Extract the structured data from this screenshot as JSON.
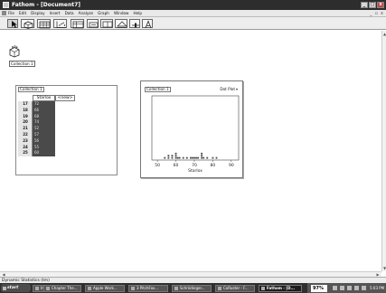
{
  "window": {
    "title": "Fathom - [Document7]",
    "controls": [
      "_",
      "□",
      "x"
    ]
  },
  "menubar": {
    "items": [
      "File",
      "Edit",
      "Display",
      "Insert",
      "Data",
      "Analyze",
      "Graph",
      "Window",
      "Help"
    ],
    "mdi_controls": [
      "_",
      "▫",
      "x"
    ]
  },
  "toolbar": {
    "tools": [
      "pointer-tool",
      "collection-tool",
      "table-tool",
      "graph-tool",
      "summary-table-tool",
      "estimate-tool",
      "test-tool",
      "model-tool",
      "slider-tool",
      "text-tool"
    ]
  },
  "collection_icon": {
    "label": "Collection 1"
  },
  "case_table": {
    "title": "Collection 1",
    "headers": [
      "Starlox",
      "<new>"
    ],
    "rows": [
      {
        "n": "17",
        "v": "72"
      },
      {
        "n": "18",
        "v": "66"
      },
      {
        "n": "19",
        "v": "68"
      },
      {
        "n": "20",
        "v": "74"
      },
      {
        "n": "21",
        "v": "52"
      },
      {
        "n": "22",
        "v": "57"
      },
      {
        "n": "23",
        "v": "56"
      },
      {
        "n": "24",
        "v": "55"
      },
      {
        "n": "25",
        "v": "60"
      }
    ]
  },
  "graph": {
    "title": "Collection 1",
    "type_menu": "Dot Plot"
  },
  "chart_data": {
    "type": "scatter",
    "x": [
      54,
      56,
      56,
      58,
      58,
      60,
      60,
      60,
      61,
      62,
      64,
      66,
      68,
      69,
      70,
      71,
      72,
      74,
      74,
      74,
      75,
      77,
      80,
      82
    ],
    "y": [
      1,
      1,
      2,
      1,
      2,
      1,
      2,
      3,
      1,
      1,
      1,
      1,
      1,
      1,
      1,
      1,
      1,
      1,
      2,
      3,
      1,
      1,
      1,
      1
    ],
    "xticks": [
      "50",
      "60",
      "70",
      "80",
      "90"
    ],
    "xlabel": "Starlox",
    "xlim": [
      47,
      94
    ],
    "ylim": [
      0,
      20
    ],
    "grid": false
  },
  "statusbar": {
    "text": "Dynamic Statistics (tm)"
  },
  "taskbar": {
    "start": "start",
    "tasks": [
      "Inbox - Mi...",
      "Chapter The...",
      "Apple Work...",
      "3 PitchFox...",
      "Schrödinger...",
      "CoRuster - F...",
      "Fathom - [D..."
    ],
    "zoom": "97%",
    "clock": "5:03 PM"
  },
  "colors": {
    "titlebar": "#2d2d2d",
    "taskbar": "#2f2f2f",
    "selected_cells": "#4a4a4a"
  }
}
